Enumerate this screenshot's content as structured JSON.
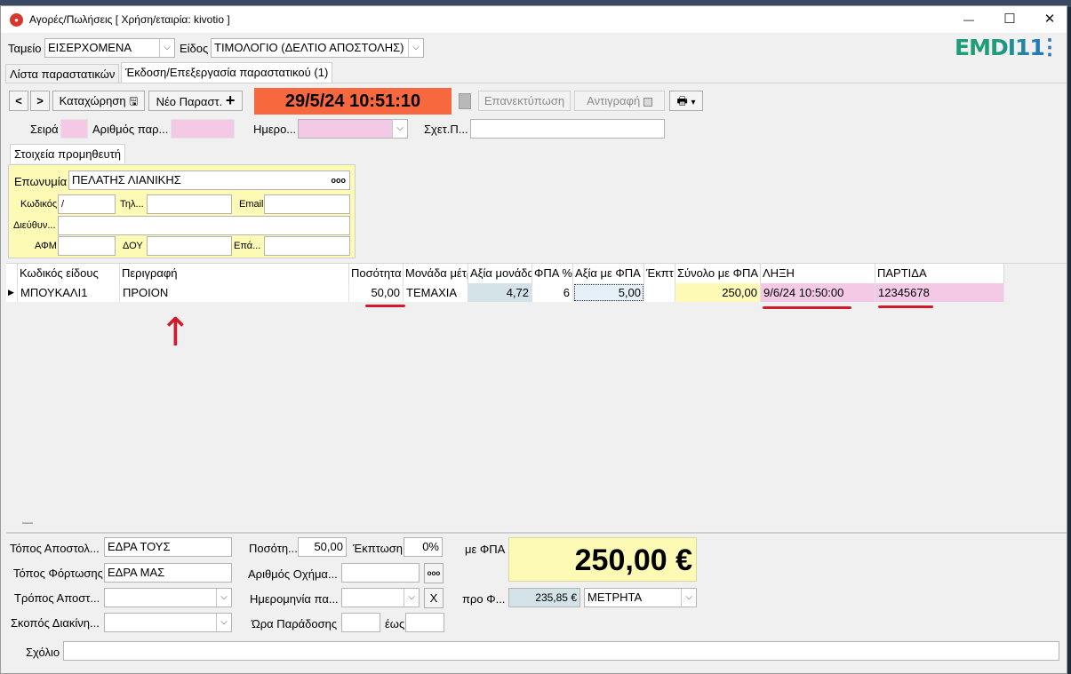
{
  "window": {
    "title": "Αγορές/Πωλήσεις   [ Χρήση/εταιρία: kivotio ]",
    "app_icon": "app-logo-icon",
    "minimize_glyph": "—",
    "maximize_glyph": "☐",
    "close_glyph": "✕"
  },
  "top": {
    "tameio_label": "Ταμείο",
    "tameio_value": "ΕΙΣΕΡΧΟΜΕΝΑ",
    "eidos_label": "Είδος",
    "eidos_value": "ΤΙΜΟΛΟΓΙΟ (ΔΕΛΤΙΟ ΑΠΟΣΤΟΛΗΣ)",
    "brand": "EMDI11",
    "menu_glyph": "⋮"
  },
  "tabs": [
    {
      "label": "Λίστα παραστατικών"
    },
    {
      "label": "Έκδοση/Επεξεργασία παραστατικού (1)"
    }
  ],
  "toolbar": {
    "prev_glyph": "<",
    "next_glyph": ">",
    "save_label": "Καταχώρηση",
    "save_glyph": "🖫",
    "new_label": "Νέο Παραστ.",
    "new_glyph": "+",
    "datetime": "29/5/24 10:51:10",
    "reprint_label": "Επανεκτύπωση",
    "copy_label": "Αντιγραφή",
    "print_glyph": "🖶",
    "print_arrow": "▾"
  },
  "doc": {
    "seira_label": "Σειρά",
    "seira_value": "",
    "arithmos_label": "Αριθμός παρ...",
    "arithmos_value": "",
    "date_label": "Ημερο...",
    "date_value": "",
    "sxet_label": "Σχετ.Π...",
    "sxet_value": ""
  },
  "supplier": {
    "tab_label": "Στοιχεία προμηθευτή",
    "eponymia_label": "Επωνυμία",
    "eponymia_value": "ΠΕΛΑΤΗΣ ΛΙΑΝΙΚΗΣ",
    "more_glyph": "ooo",
    "kodikos_label": "Κωδικός",
    "kodikos_value": "/",
    "til_label": "Τηλ...",
    "til_value": "",
    "email_label": "Email",
    "email_value": "",
    "dieuth_label": "Διεύθυν...",
    "dieuth_value": "",
    "afm_label": "ΑΦΜ",
    "afm_value": "",
    "doy_label": "ΔΟΥ",
    "doy_value": "",
    "epa_label": "Επά...",
    "epa_value": ""
  },
  "grid": {
    "columns": [
      "Κωδικός είδους",
      "Περιγραφή",
      "Ποσότητα",
      "Μονάδα μέτρ",
      "Αξία μονάδα",
      "ΦΠΑ %",
      "Αξία με ΦΠΑ",
      "Έκπτ",
      "Σύνολο με ΦΠΑ",
      "ΛΗΞΗ",
      "ΠΑΡΤΙΔΑ"
    ],
    "row_marker": "▶",
    "rows": [
      {
        "code": "ΜΠΟΥΚΑΛΙ1",
        "desc": "ΠΡΟΙΟΝ",
        "qty": "50,00",
        "unit": "ΤΕΜΑΧΙΑ",
        "unit_price": "4,72",
        "vat": "6",
        "price_vat": "5,00",
        "discount": "",
        "total": "250,00",
        "expiry": "9/6/24 10:50:00",
        "batch": "12345678"
      }
    ],
    "arrow_glyph": "↑",
    "splitter_glyph": "—"
  },
  "footer": {
    "topos_apost_label": "Τόπος Αποστολ...",
    "topos_apost_value": "ΕΔΡΑ ΤΟΥΣ",
    "topos_fort_label": "Τόπος Φόρτωσης",
    "topos_fort_value": "ΕΔΡΑ ΜΑΣ",
    "tropos_label": "Τρόπος Αποστ...",
    "tropos_value": "",
    "skopos_label": "Σκοπός Διακίνη...",
    "skopos_value": "",
    "posot_label": "Ποσότη...",
    "posot_value": "50,00",
    "ekptosi_label": "Έκπτωση",
    "ekptosi_value": "0%",
    "arithmos_ox_label": "Αριθμός Οχήμα...",
    "arithmos_ox_value": "",
    "imerominia_label": "Ημερομηνία πα...",
    "imerominia_value": "",
    "clear_glyph": "X",
    "ora_label": "Ώρα Παράδοσης",
    "ora_value": "",
    "eos_label": "έως",
    "eos_value": "",
    "me_fpa_label": "με ΦΠΑ",
    "total": "250,00 €",
    "pro_fpa_label": "προ Φ...",
    "pro_fpa_value": "235,85 €",
    "payment_value": "ΜΕΤΡΗΤΑ",
    "sxolio_label": "Σχόλιο",
    "sxolio_value": ""
  },
  "colors": {
    "accent_orange": "#f7683f",
    "pink_field": "#f3c9e6",
    "yellow_field": "#fcfab4",
    "blue_field": "#d2e2e6",
    "annotation_red": "#d21a2a",
    "brand_green": "#1f9c78",
    "brand_blue": "#2474c2"
  }
}
